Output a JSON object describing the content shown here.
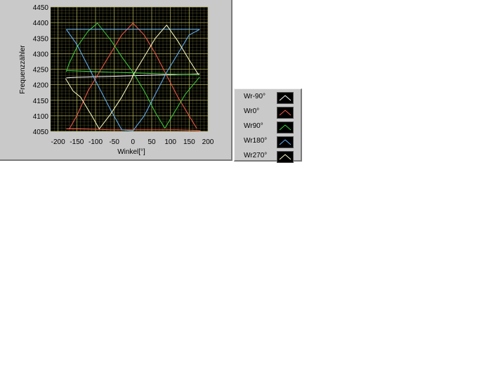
{
  "chart_data": {
    "type": "line",
    "xlabel": "Winkel[°]",
    "ylabel": "Frequenzzähler",
    "xlim": [
      -220,
      200
    ],
    "ylim": [
      4050,
      4450
    ],
    "xticks": [
      -200,
      -150,
      -100,
      -50,
      0,
      50,
      100,
      150,
      200
    ],
    "yticks": [
      4050,
      4100,
      4150,
      4200,
      4250,
      4300,
      4350,
      4400,
      4450
    ],
    "grid": true,
    "legend_position": "right, outside the plot",
    "background_color": "#000000",
    "grid_color": "#b4b45a",
    "series": [
      {
        "name": "Wr-90°",
        "color": "#ffffff",
        "x": [
          -178,
          -165,
          -150,
          -120,
          -90,
          -60,
          -30,
          0,
          30,
          60,
          90,
          120,
          150,
          178
        ],
        "y": [
          4222,
          4223,
          4224,
          4225,
          4226,
          4227,
          4228,
          4229,
          4230,
          4231,
          4232,
          4233,
          4234,
          4235
        ]
      },
      {
        "name": "Wr0°",
        "color": "#ff5a4a",
        "x": [
          -178,
          -170,
          -150,
          -120,
          -90,
          -60,
          -30,
          0,
          30,
          60,
          90,
          120,
          150,
          175,
          180
        ],
        "y": [
          4058,
          4058,
          4058,
          4057,
          4056,
          4055,
          4055,
          4055,
          4055,
          4055,
          4055,
          4055,
          4054,
          4053,
          4052
        ]
      },
      {
        "name": "Wr0°",
        "color": "#ff5a4a",
        "x": [
          -170,
          -150,
          -120,
          -90,
          -60,
          -30,
          0,
          30,
          60,
          90,
          120,
          150,
          170
        ],
        "y": [
          4058,
          4100,
          4180,
          4240,
          4300,
          4360,
          4398,
          4360,
          4300,
          4230,
          4160,
          4100,
          4060
        ]
      },
      {
        "name": "Wr90°",
        "color": "#3cd23c",
        "x": [
          -178,
          -170,
          -150,
          -120,
          -95,
          -60,
          -30,
          0,
          30,
          60,
          85,
          110,
          140,
          178
        ],
        "y": [
          4242,
          4270,
          4320,
          4372,
          4398,
          4345,
          4290,
          4240,
          4180,
          4110,
          4060,
          4110,
          4170,
          4225
        ]
      },
      {
        "name": "Wr90°",
        "color": "#3cd23c",
        "x": [
          -178,
          -120,
          -60,
          0,
          60,
          120,
          178
        ],
        "y": [
          4246,
          4243,
          4240,
          4238,
          4236,
          4234,
          4233
        ]
      },
      {
        "name": "Wr180°",
        "color": "#64b4ff",
        "x": [
          -178,
          -150,
          -120,
          -90,
          -60,
          -30,
          0,
          30,
          60,
          90,
          120,
          150,
          178
        ],
        "y": [
          4378,
          4330,
          4260,
          4190,
          4120,
          4055,
          4052,
          4100,
          4170,
          4240,
          4300,
          4360,
          4378
        ]
      },
      {
        "name": "Wr180°",
        "color": "#64b4ff",
        "x": [
          -178,
          -120,
          -60,
          0,
          60,
          120,
          178
        ],
        "y": [
          4378,
          4378,
          4378,
          4378,
          4378,
          4378,
          4378
        ]
      },
      {
        "name": "Wr270°",
        "color": "#ffffc8",
        "x": [
          -180,
          -170,
          -160,
          -140,
          -110,
          -90,
          -60,
          -30,
          -5,
          0,
          30,
          60,
          90,
          120,
          150,
          175
        ],
        "y": [
          4220,
          4200,
          4180,
          4160,
          4100,
          4058,
          4105,
          4160,
          4215,
          4230,
          4290,
          4350,
          4392,
          4340,
          4280,
          4232
        ]
      }
    ]
  },
  "legend": {
    "items": [
      {
        "label": "Wr-90°",
        "color": "#ffffff"
      },
      {
        "label": "Wr0°",
        "color": "#ff5a4a"
      },
      {
        "label": "Wr90°",
        "color": "#3cd23c"
      },
      {
        "label": "Wr180°",
        "color": "#64b4ff"
      },
      {
        "label": "Wr270°",
        "color": "#ffffc8"
      }
    ]
  }
}
